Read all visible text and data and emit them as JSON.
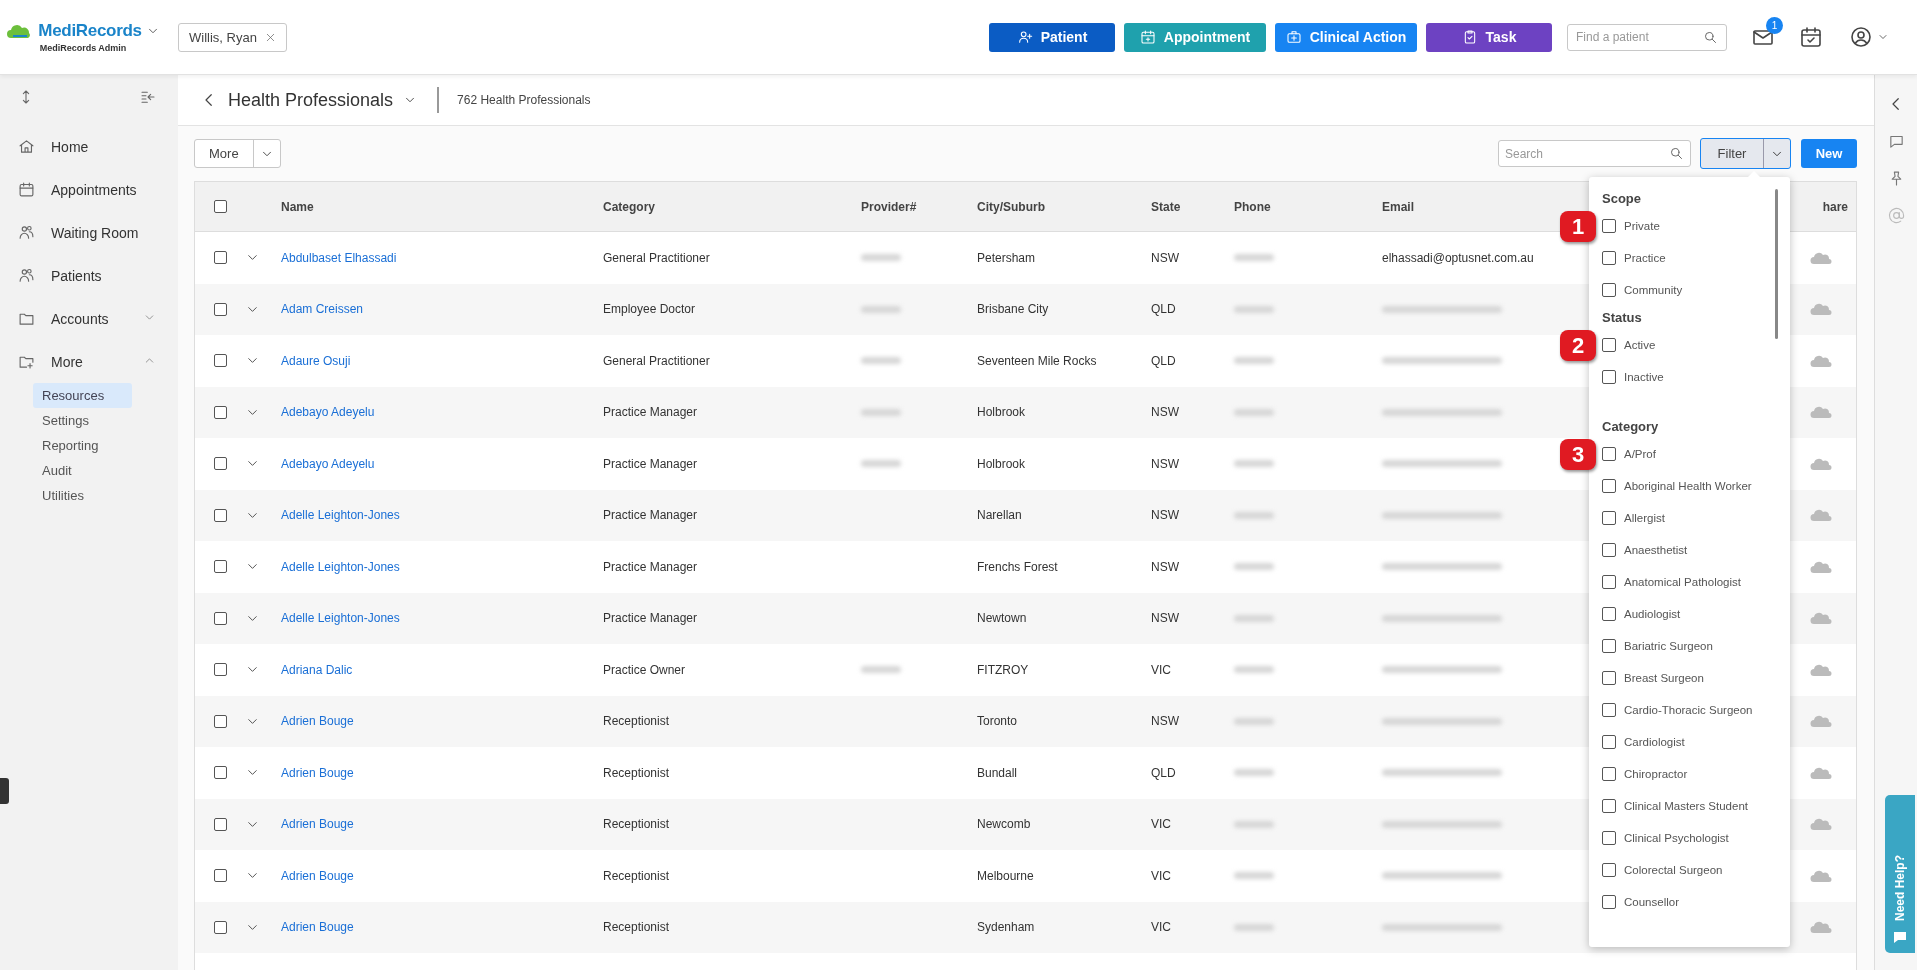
{
  "header": {
    "brand": "MediRecords",
    "subtitle": "MediRecords Admin",
    "patient_tab": "Willis, Ryan",
    "actions": [
      {
        "label": "Patient",
        "color": "#0b5cc4"
      },
      {
        "label": "Appointment",
        "color": "#1fa1ad"
      },
      {
        "label": "Clinical Action",
        "color": "#1784f2"
      },
      {
        "label": "Task",
        "color": "#6d42c2"
      }
    ],
    "search": {
      "placeholder": "Find a patient"
    },
    "mail_badge": "1"
  },
  "sidebar": {
    "items": [
      {
        "label": "Home",
        "selected": false
      },
      {
        "label": "Appointments",
        "selected": false
      },
      {
        "label": "Waiting Room",
        "selected": false
      },
      {
        "label": "Patients",
        "selected": false
      },
      {
        "label": "Accounts",
        "expanded": false,
        "selected": false
      },
      {
        "label": "More",
        "expanded": true,
        "selected": false,
        "children": [
          {
            "label": "Resources",
            "selected": true
          },
          {
            "label": "Settings",
            "selected": false
          },
          {
            "label": "Reporting",
            "selected": false
          },
          {
            "label": "Audit",
            "selected": false
          },
          {
            "label": "Utilities",
            "selected": false
          }
        ]
      }
    ]
  },
  "page": {
    "title": "Health Professionals",
    "count": "762 Health Professionals"
  },
  "toolbar": {
    "more": "More",
    "search": {
      "placeholder": "Search"
    },
    "filter": "Filter",
    "new": "New"
  },
  "table": {
    "select_all_checked": false,
    "columns": [
      "Name",
      "Category",
      "Provider#",
      "City/Suburb",
      "State",
      "Phone",
      "Email",
      "hare"
    ],
    "rows": [
      {
        "name": "Abdulbaset Elhassadi",
        "category": "General Practitioner",
        "provider_redacted": true,
        "city": "Petersham",
        "state": "NSW",
        "email": "elhassadi@optusnet.com.au",
        "checked": false
      },
      {
        "name": "Adam Creissen",
        "category": "Employee Doctor",
        "provider_redacted": true,
        "city": "Brisbane City",
        "state": "QLD",
        "checked": false
      },
      {
        "name": "Adaure Osuji",
        "category": "General Practitioner",
        "provider_redacted": true,
        "city": "Seventeen Mile Rocks",
        "state": "QLD",
        "checked": false
      },
      {
        "name": "Adebayo Adeyelu",
        "category": "Practice Manager",
        "provider_redacted": true,
        "city": "Holbrook",
        "state": "NSW",
        "checked": false
      },
      {
        "name": "Adebayo Adeyelu",
        "category": "Practice Manager",
        "provider_redacted": true,
        "city": "Holbrook",
        "state": "NSW",
        "checked": false
      },
      {
        "name": "Adelle Leighton-Jones",
        "category": "Practice Manager",
        "provider_redacted": false,
        "city": "Narellan",
        "state": "NSW",
        "checked": false
      },
      {
        "name": "Adelle Leighton-Jones",
        "category": "Practice Manager",
        "provider_redacted": false,
        "city": "Frenchs Forest",
        "state": "NSW",
        "checked": false
      },
      {
        "name": "Adelle Leighton-Jones",
        "category": "Practice Manager",
        "provider_redacted": false,
        "city": "Newtown",
        "state": "NSW",
        "checked": false
      },
      {
        "name": "Adriana Dalic",
        "category": "Practice Owner",
        "provider_redacted": true,
        "city": "FITZROY",
        "state": "VIC",
        "checked": false
      },
      {
        "name": "Adrien Bouge",
        "category": "Receptionist",
        "provider_redacted": false,
        "city": "Toronto",
        "state": "NSW",
        "checked": false
      },
      {
        "name": "Adrien Bouge",
        "category": "Receptionist",
        "provider_redacted": false,
        "city": "Bundall",
        "state": "QLD",
        "checked": false
      },
      {
        "name": "Adrien Bouge",
        "category": "Receptionist",
        "provider_redacted": false,
        "city": "Newcomb",
        "state": "VIC",
        "checked": false
      },
      {
        "name": "Adrien Bouge",
        "category": "Receptionist",
        "provider_redacted": false,
        "city": "Melbourne",
        "state": "VIC",
        "checked": false
      },
      {
        "name": "Adrien Bouge",
        "category": "Receptionist",
        "provider_redacted": false,
        "city": "Sydenham",
        "state": "VIC",
        "checked": false
      }
    ]
  },
  "filter": {
    "sections": [
      {
        "title": "Scope",
        "marker": "1",
        "options": [
          {
            "label": "Private",
            "checked": false
          },
          {
            "label": "Practice",
            "checked": false
          },
          {
            "label": "Community",
            "checked": false
          }
        ]
      },
      {
        "title": "Status",
        "marker": "2",
        "options": [
          {
            "label": "Active",
            "checked": false
          },
          {
            "label": "Inactive",
            "checked": false
          }
        ]
      },
      {
        "title": "Category",
        "marker": "3",
        "options": [
          {
            "label": "A/Prof",
            "checked": false
          },
          {
            "label": "Aboriginal Health Worker",
            "checked": false
          },
          {
            "label": "Allergist",
            "checked": false
          },
          {
            "label": "Anaesthetist",
            "checked": false
          },
          {
            "label": "Anatomical Pathologist",
            "checked": false
          },
          {
            "label": "Audiologist",
            "checked": false
          },
          {
            "label": "Bariatric Surgeon",
            "checked": false
          },
          {
            "label": "Breast Surgeon",
            "checked": false
          },
          {
            "label": "Cardio-Thoracic Surgeon",
            "checked": false
          },
          {
            "label": "Cardiologist",
            "checked": false
          },
          {
            "label": "Chiropractor",
            "checked": false
          },
          {
            "label": "Clinical Masters Student",
            "checked": false
          },
          {
            "label": "Clinical Psychologist",
            "checked": false
          },
          {
            "label": "Colorectal Surgeon",
            "checked": false
          },
          {
            "label": "Counsellor",
            "checked": false
          }
        ]
      }
    ]
  },
  "help_tab": "Need Help?"
}
